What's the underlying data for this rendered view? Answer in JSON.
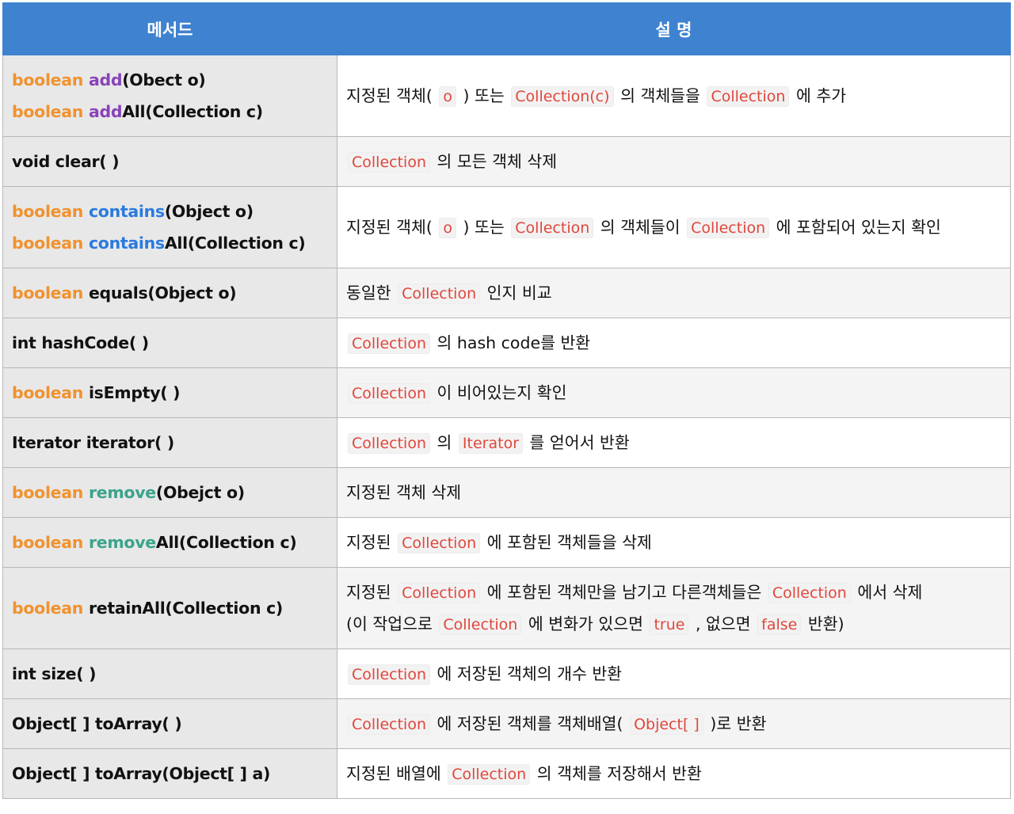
{
  "header": {
    "method": "메서드",
    "description": "설 명"
  },
  "rows": [
    {
      "m": [
        [
          "boolean ",
          "o"
        ],
        [
          "add",
          "p"
        ],
        [
          "(Obect o)",
          ""
        ]
      ],
      "m2": [
        [
          "boolean ",
          "o"
        ],
        [
          "add",
          "p"
        ],
        [
          "All(Collection c)",
          ""
        ]
      ],
      "d": [
        [
          "지정된 객체(",
          ""
        ],
        [
          "o",
          "c"
        ],
        [
          ") 또는",
          ""
        ],
        [
          "Collection(c)",
          "c"
        ],
        [
          "의 객체들을",
          ""
        ],
        [
          "Collection",
          "c"
        ],
        [
          "에 추가",
          ""
        ]
      ]
    },
    {
      "m": [
        [
          "void clear( )",
          ""
        ]
      ],
      "d": [
        [
          "Collection",
          "c"
        ],
        [
          "의 모든 객체 삭제",
          ""
        ]
      ]
    },
    {
      "m": [
        [
          "boolean ",
          "o"
        ],
        [
          "contains",
          "b"
        ],
        [
          "(Object o)",
          ""
        ]
      ],
      "m2": [
        [
          "boolean ",
          "o"
        ],
        [
          "contains",
          "b"
        ],
        [
          "All(Collection c)",
          ""
        ]
      ],
      "d": [
        [
          "지정된 객체(",
          ""
        ],
        [
          "o",
          "c"
        ],
        [
          ") 또는",
          ""
        ],
        [
          "Collection",
          "c"
        ],
        [
          "의 객체들이",
          ""
        ],
        [
          "Collection",
          "c"
        ],
        [
          "에 포함되어 있는지 확인",
          ""
        ]
      ]
    },
    {
      "m": [
        [
          "boolean ",
          "o"
        ],
        [
          "equals(Object o)",
          ""
        ]
      ],
      "d": [
        [
          "동일한",
          ""
        ],
        [
          "Collection",
          "c"
        ],
        [
          "인지 비교",
          ""
        ]
      ]
    },
    {
      "m": [
        [
          "int hashCode( )",
          ""
        ]
      ],
      "d": [
        [
          "Collection",
          "c"
        ],
        [
          "의 hash code를 반환",
          ""
        ]
      ]
    },
    {
      "m": [
        [
          "boolean ",
          "o"
        ],
        [
          "isEmpty( )",
          ""
        ]
      ],
      "d": [
        [
          "Collection",
          "c"
        ],
        [
          "이 비어있는지 확인",
          ""
        ]
      ]
    },
    {
      "m": [
        [
          "Iterator iterator( )",
          ""
        ]
      ],
      "d": [
        [
          "Collection",
          "c"
        ],
        [
          "의",
          ""
        ],
        [
          "Iterator",
          "c"
        ],
        [
          "를 얻어서 반환",
          ""
        ]
      ]
    },
    {
      "m": [
        [
          "boolean ",
          "o"
        ],
        [
          "remove",
          "t"
        ],
        [
          "(Obejct o)",
          ""
        ]
      ],
      "d": [
        [
          "지정된 객체 삭제",
          ""
        ]
      ]
    },
    {
      "m": [
        [
          "boolean ",
          "o"
        ],
        [
          "remove",
          "t"
        ],
        [
          "All(Collection c)",
          ""
        ]
      ],
      "d": [
        [
          "지정된",
          ""
        ],
        [
          "Collection",
          "c"
        ],
        [
          "에 포함된 객체들을 삭제",
          ""
        ]
      ]
    },
    {
      "m": [
        [
          "boolean ",
          "o"
        ],
        [
          "retainAll(Collection c)",
          ""
        ]
      ],
      "d": [
        [
          "지정된",
          ""
        ],
        [
          "Collection",
          "c"
        ],
        [
          "에 포함된 객체만을 남기고 다른객체들은",
          ""
        ],
        [
          "Collection",
          "c"
        ],
        [
          "에서 삭제",
          ""
        ]
      ],
      "d2": [
        [
          "(이 작업으로",
          ""
        ],
        [
          "Collection",
          "c"
        ],
        [
          "에 변화가 있으면",
          ""
        ],
        [
          "true",
          "c"
        ],
        [
          ", 없으면",
          ""
        ],
        [
          "false",
          "c"
        ],
        [
          "반환)",
          ""
        ]
      ]
    },
    {
      "m": [
        [
          "int size( )",
          ""
        ]
      ],
      "d": [
        [
          "Collection",
          "c"
        ],
        [
          "에 저장된 객체의 개수 반환",
          ""
        ]
      ]
    },
    {
      "m": [
        [
          "Object[ ] toArray( )",
          ""
        ]
      ],
      "d": [
        [
          "Collection",
          "c"
        ],
        [
          "에 저장된 객체를 객체배열(",
          ""
        ],
        [
          "Object[ ]",
          "c"
        ],
        [
          ")로 반환",
          ""
        ]
      ]
    },
    {
      "m": [
        [
          "Object[ ] toArray(Object[ ] a)",
          ""
        ]
      ],
      "d": [
        [
          "지정된 배열에",
          ""
        ],
        [
          "Collection",
          "c"
        ],
        [
          "의 객체를 저장해서 반환",
          ""
        ]
      ]
    }
  ]
}
